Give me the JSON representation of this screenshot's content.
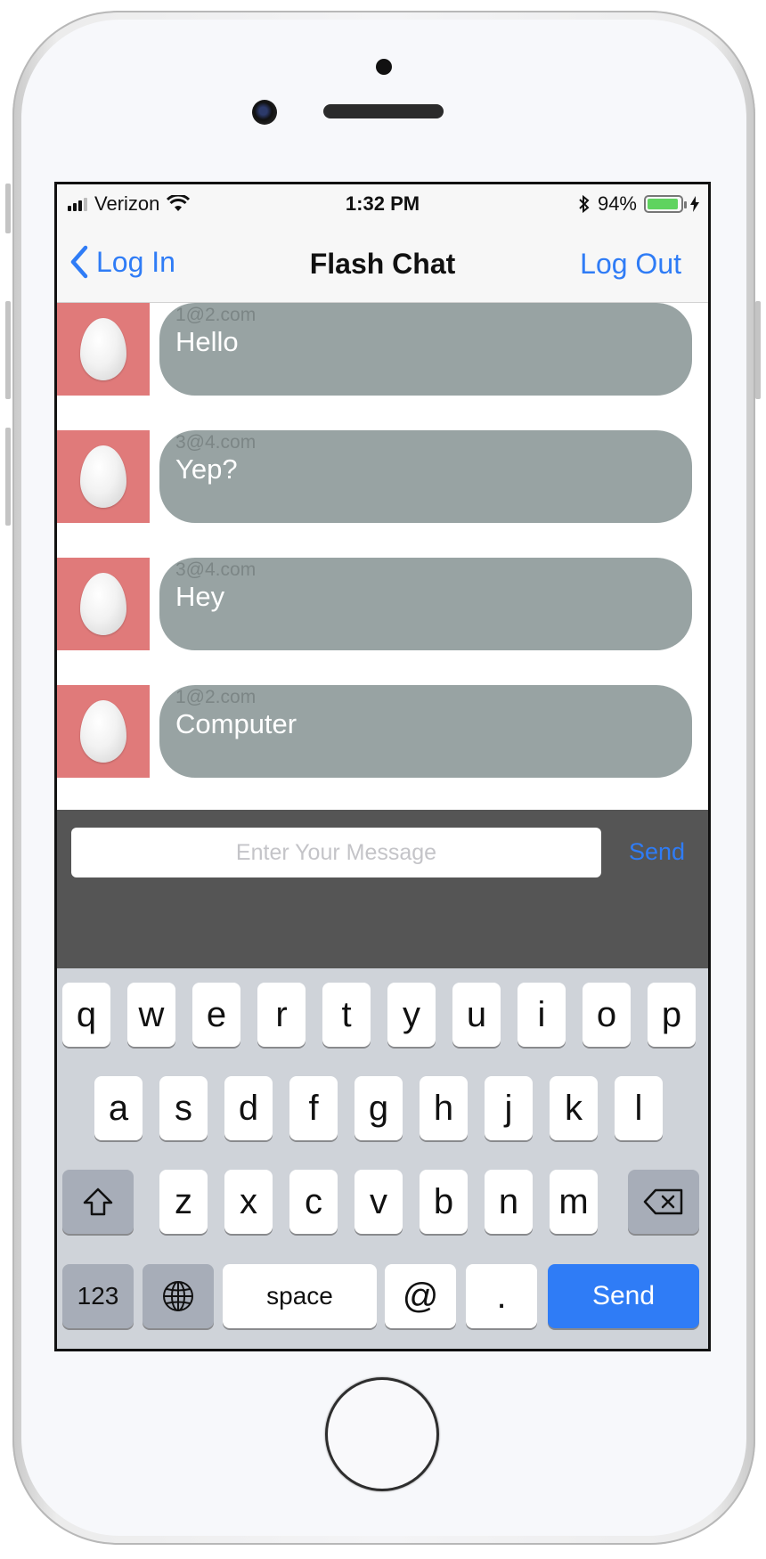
{
  "status_bar": {
    "carrier": "Verizon",
    "time": "1:32 PM",
    "battery": "94%",
    "battery_level": 0.94
  },
  "nav": {
    "back_label": "Log In",
    "title": "Flash Chat",
    "right_label": "Log Out"
  },
  "messages": [
    {
      "sender": "1@2.com",
      "text": "Hello"
    },
    {
      "sender": "3@4.com",
      "text": "Yep?"
    },
    {
      "sender": "3@4.com",
      "text": "Hey"
    },
    {
      "sender": "1@2.com",
      "text": "Computer"
    }
  ],
  "composer": {
    "placeholder": "Enter Your Message",
    "value": "",
    "send_label": "Send"
  },
  "keyboard": {
    "row1": [
      "q",
      "w",
      "e",
      "r",
      "t",
      "y",
      "u",
      "i",
      "o",
      "p"
    ],
    "row2": [
      "a",
      "s",
      "d",
      "f",
      "g",
      "h",
      "j",
      "k",
      "l"
    ],
    "row3": [
      "z",
      "x",
      "c",
      "v",
      "b",
      "n",
      "m"
    ],
    "numbers_label": "123",
    "space_label": "space",
    "at_label": "@",
    "dot_label": ".",
    "send_label": "Send"
  },
  "colors": {
    "accent": "#2f7cf6",
    "bubble": "#98a3a3",
    "avatar_bg": "#e07a7a",
    "composer_bg": "#555555",
    "keyboard_bg": "#cfd3d9"
  }
}
